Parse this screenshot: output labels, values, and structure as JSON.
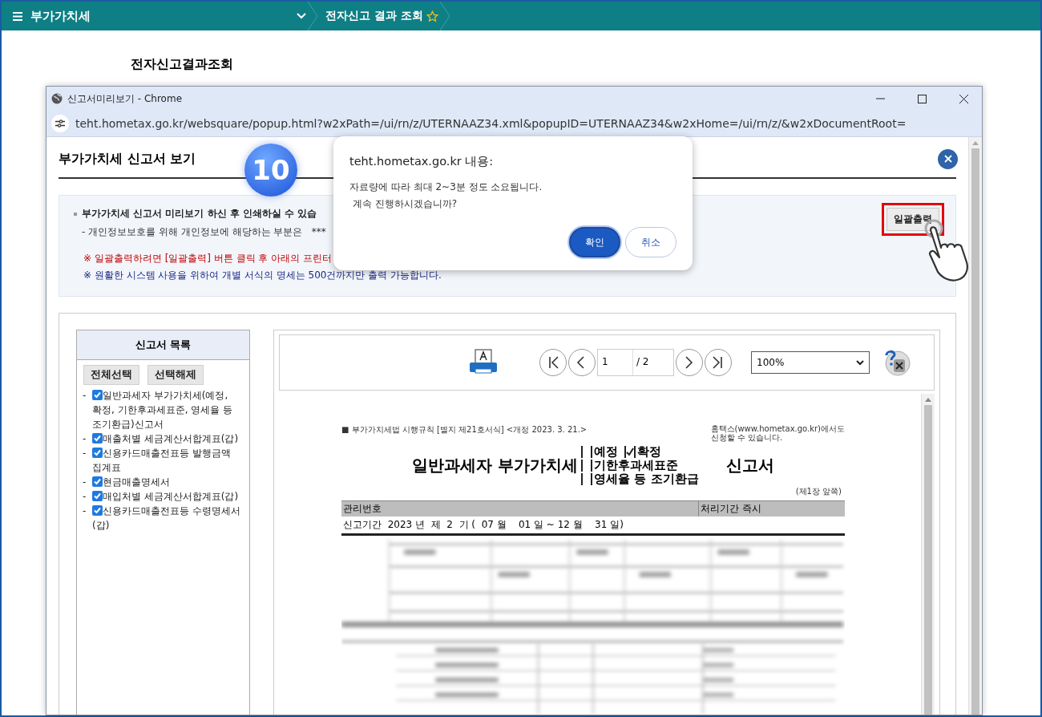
{
  "header": {
    "menu_title": "부가가치세",
    "breadcrumb": "전자신고 결과 조회",
    "favorite": false
  },
  "page_title": "전자신고결과조회",
  "popup": {
    "title": "신고서미리보기 - Chrome",
    "url": "teht.hometax.go.kr/websquare/popup.html?w2xPath=/ui/rn/z/UTERNAAZ34.xml&popupID=UTERNAAZ34&w2xHome=/ui/rn/z/&w2xDocumentRoot="
  },
  "panel": {
    "title": "부가가치세 신고서 보기",
    "step_badge": "10"
  },
  "notice": {
    "lines": [
      {
        "kind": "bold",
        "text": "부가가치세 신고서 미리보기 하신 후 인쇄하실 수 있습"
      },
      {
        "kind": "sub",
        "text": "- 개인정보보호를 위해 개인정보에 해당하는 부분은   ***"
      },
      {
        "kind": "warn",
        "text": "※ 일괄출력하려면 [일괄출력] 버튼 클릭 후 아래의 프린터"
      },
      {
        "kind": "info",
        "text": "※ 원활한 시스템 사용을 위하여 개별 서식의 명세는 500건까지만 출력 가능합니다."
      }
    ],
    "print_all_button": "일괄출력",
    "highlighted": true
  },
  "form_list": {
    "title": "신고서 목록",
    "buttons": [
      "전체선택",
      "선택해제"
    ],
    "items": [
      {
        "bullet": "-",
        "label": "일반과세자 부가가치세(예정, 확정, 기한후과세표준, 영세율 등 조기환급)신고서",
        "checked": true
      },
      {
        "bullet": "-",
        "label": "매출처별 세금계산서합계표(갑)",
        "checked": true
      },
      {
        "bullet": "-",
        "label": "신용카드매출전표등 발행금액 집계표",
        "checked": true
      },
      {
        "bullet": "-",
        "label": "현금매출명세서",
        "checked": true
      },
      {
        "bullet": "-",
        "label": "매입처별 세금계산서합계표(갑)",
        "checked": true
      },
      {
        "bullet": "-",
        "label": "신용카드매출전표등 수령명세서(갑)",
        "checked": true
      }
    ]
  },
  "viewer": {
    "page": "1",
    "total": "/ 2",
    "zoom": "100%"
  },
  "document": {
    "rule": "■ 부가가치세법 시행규칙 [별지 제21호서식] <개정 2023. 3. 21.>",
    "note": [
      "홈택스(www.hometax.go.kr)에서도",
      "신청할 수 있습니다."
    ],
    "title": "일반과세자 부가가치세",
    "options": [
      [
        {
          "label": "예정",
          "checked": false
        },
        {
          "label": "확정",
          "checked": true
        }
      ],
      [
        {
          "label": "기한후과세표준",
          "checked": false
        }
      ],
      [
        {
          "label": "영세율 등 조기환급",
          "checked": false
        }
      ]
    ],
    "title_end": "신고서",
    "page_note": "(제1장 앞쪽)",
    "head_cells": [
      "관리번호",
      "처리기간 즉시"
    ],
    "period": "신고기간  2023 년  제  2  기 (  07 월    01 일 ~ 12 월    31 일)"
  },
  "dialog": {
    "title": "teht.hometax.go.kr 내용:",
    "message": [
      "자료량에 따라 최대 2~3분 정도 소요됩니다.",
      " 계속 진행하시겠습니까?"
    ],
    "buttons": [
      {
        "label": "확인",
        "selected": true
      },
      {
        "label": "취소",
        "selected": false
      }
    ]
  }
}
